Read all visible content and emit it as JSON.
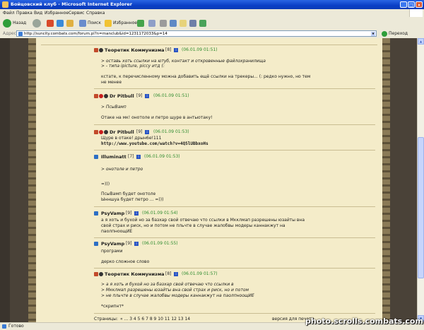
{
  "window": {
    "title": "Бойцовский клуб - Microsoft Internet Explorer",
    "min": "_",
    "max": "□",
    "close": "×"
  },
  "menu": [
    "Файл",
    "Правка",
    "Вид",
    "Избранное",
    "Сервис",
    "Справка"
  ],
  "toolbar": {
    "back": "Назад",
    "search": "Поиск",
    "favorites": "Избранное"
  },
  "address": {
    "label": "Адрес",
    "url": "http://suncity.combats.com/forum.pl?n=manclub&id=1231172033&p=14",
    "go": "Переход"
  },
  "posts": [
    {
      "user": "Теоретик Коммунизма",
      "level": "[8]",
      "time": "(06.01.09 01:51)",
      "lines": [
        {
          "text": "> оставь хоть ссылки на ютуб, контакт и откровенные файлохранилища",
          "quote": true
        },
        {
          "text": "> - типа ipicture, piccy итд (:",
          "quote": true
        },
        {
          "text": ""
        },
        {
          "text": "кстате, к перечисленному можна добавить ещё ссылки на трекеры... (: редко нужно, но тем",
          "quote": false
        },
        {
          "text": "не менее",
          "quote": false
        }
      ]
    },
    {
      "user": "Dr Pitbull",
      "level": "[9]",
      "time": "(06.01.09 01:51)",
      "lines": [
        {
          "text": "> ПсыВамп",
          "quote": true
        },
        {
          "text": ""
        },
        {
          "text": "Отаке на мк! онотоле и петро щуре в антыотаку!",
          "quote": false
        }
      ]
    },
    {
      "user": "Dr Pitbull",
      "level": "[9]",
      "time": "(06.01.09 01:53)",
      "lines": [
        {
          "text": "Щуре в отаке! дрын6е!111",
          "quote": false
        },
        {
          "text": "http://www.youtube.com/watch?v=4Q5lUBbxoHs",
          "link": true
        }
      ]
    },
    {
      "user": "Illuminatt",
      "level": "[7]",
      "time": "(06.01.09 01:53)",
      "lines": [
        {
          "text": "> онотоле и петро",
          "quote": true
        },
        {
          "text": ""
        },
        {
          "text": ""
        },
        {
          "text": "=)))",
          "quote": false
        },
        {
          "text": ""
        },
        {
          "text": "ПсыВамп будет онотоле",
          "quote": false
        },
        {
          "text": "Ынншуа будет петро ... =)))",
          "quote": false
        }
      ]
    },
    {
      "user": "PsyVamp",
      "level": "[9]",
      "time": "(06.01.09 01:54)",
      "lines": [
        {
          "text": "а я хоть и бухой но за базхар свой отвечаю что ссылки в Мкклмап разрешены юзайты вна",
          "quote": false
        },
        {
          "text": "свой страх и риск, но и потом не пльчте в случае жалобвы модеры каннакжут на",
          "quote": false
        },
        {
          "text": "паолпноощИЕ",
          "quote": false
        }
      ]
    },
    {
      "user": "PsyVamp",
      "level": "[9]",
      "time": "(06.01.09 01:55)",
      "lines": [
        {
          "text": "програми",
          "quote": false
        },
        {
          "text": ""
        },
        {
          "text": "дерко сложное слово",
          "quote": false
        }
      ]
    },
    {
      "user": "Теоретик Коммунизма",
      "level": "[8]",
      "time": "(06.01.09 01:57)",
      "lines": [
        {
          "text": "> а я хоть и бухой но за базхар свой отвечаю что ссылки в",
          "quote": true
        },
        {
          "text": "> Мкклмап разрешены юзайты вна свой страх и риск, но и потом",
          "quote": true
        },
        {
          "text": "> не пльчте в случае жалобвы модеры каннакжут на паолпноощИЕ",
          "quote": true
        },
        {
          "text": ""
        },
        {
          "text": "*скрипнт*",
          "quote": false
        }
      ]
    }
  ],
  "pager": {
    "label": "Страницы:",
    "pages": "« ... 3 4 5 6 7 8 9 10 11 12 13 14",
    "print": "версия для печати"
  },
  "status": {
    "text": "Готово"
  },
  "watermark": "photo.scrolls.combats.com",
  "colors": {
    "timestamp": "#2e8b2e",
    "panel": "#f4ecc9",
    "titlebar": "#0a3fc6"
  }
}
